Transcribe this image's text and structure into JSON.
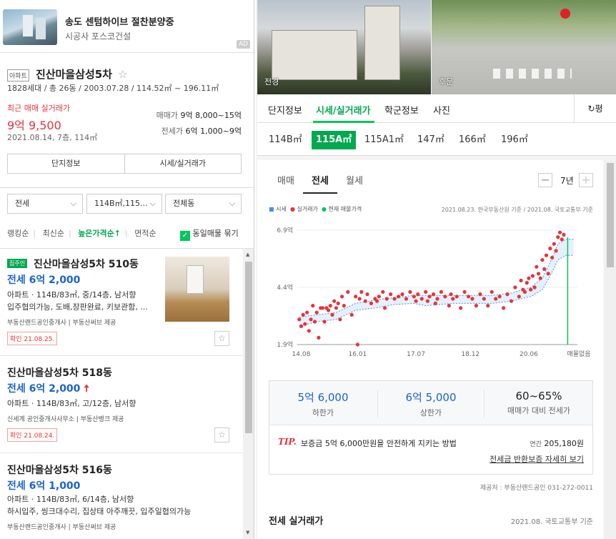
{
  "ad": {
    "title": "송도 센텀하이브 절찬분양중",
    "builder": "시공사 포스코건설",
    "badge": "AD"
  },
  "complex": {
    "type_tag": "아파트",
    "name": "진산마을삼성5차",
    "star": "☆",
    "info": "1828세대 / 총 26동 / 2003.07.28 / 114.52㎡ ~ 196.11㎡",
    "recent_label": "최근 매매 실거래가",
    "recent_price": "9억 9,500",
    "recent_meta": "2021.08.14, 7층, 114㎡",
    "sale_label": "매매가",
    "sale_range": "9억 8,000~15억",
    "jeonse_label": "전세가",
    "jeonse_range": "6억 1,000~9억",
    "btn_info": "단지정보",
    "btn_price": "시세/실거래가"
  },
  "filters": {
    "trade": "전세",
    "area": "114B㎡,115...",
    "dong": "전체동",
    "sort_ranking": "랭킹순",
    "sort_recent": "최신순",
    "sort_price": "높은가격순",
    "sort_price_arrow": "↑",
    "sort_area": "면적순",
    "group_same": "동일매물 묶기"
  },
  "listings": [
    {
      "badge": "집주인",
      "title": "진산마을삼성5차 510동",
      "price": "전세 6억 2,000",
      "desc": "아파트 · 114B/83㎡, 중/14층, 남서향",
      "extra": "입주협의가능, 도배,장판완료, 키보관함, ...",
      "source": "부동산랜드공인중개사 | 부동산써브 제공",
      "confirm": "확인 21.08.25."
    },
    {
      "title": "진산마을삼성5차 518동",
      "price": "전세 6억 2,000",
      "up": "🠅",
      "desc": "아파트 · 114B/83㎡, 고/12층, 남서향",
      "source": "신세계 공인중개사사무소 | 부동산뱅크 제공",
      "confirm": "확인 21.08.24."
    },
    {
      "title": "진산마을삼성5차 516동",
      "price": "전세 6억 1,000",
      "desc": "아파트 · 114B/83㎡, 6/14층, 남서향",
      "extra": "하시입주, 씽크대수리, 집상태 아주깨끗, 입주일협의가능",
      "source": "부동산랜드공인중개사 | 부동산써브 제공"
    }
  ],
  "photos": {
    "front": "전경",
    "back": "후문"
  },
  "detail_tabs": [
    "단지정보",
    "시세/실거래가",
    "학군정보",
    "사진"
  ],
  "refresh_label": "평",
  "sizes": [
    "114B㎡",
    "115A㎡",
    "115A1㎡",
    "147㎡",
    "166㎡",
    "196㎡"
  ],
  "price_tabs": [
    "매매",
    "전세",
    "월세"
  ],
  "period": {
    "label": "7년",
    "minus": "−",
    "plus": "+"
  },
  "legend": {
    "market": "시세",
    "real": "실거래가",
    "current": "현재 매물가격",
    "source": "2021.08.23. 한국부동산원 기준 / 2021.08. 국토교통부 기준"
  },
  "colors": {
    "accent": "#03c75a",
    "price_blue": "#1a64c8",
    "red": "#e3343c",
    "market_blue": "#4a90d9"
  },
  "chart_data": {
    "type": "scatter",
    "x_ticks": [
      "14.08",
      "16.01",
      "17.07",
      "18.12",
      "20.06"
    ],
    "y_ticks": [
      "1.9억",
      "4.4억",
      "6.9억"
    ],
    "ylim": [
      1.9,
      6.9
    ],
    "xlim": [
      2014.5,
      2021.7
    ],
    "no_listing_label": "매물없음",
    "series": [
      {
        "name": "실거래가",
        "points": [
          [
            2014.55,
            3.0
          ],
          [
            2014.6,
            2.7
          ],
          [
            2014.65,
            3.2
          ],
          [
            2014.7,
            2.8
          ],
          [
            2014.75,
            3.3
          ],
          [
            2014.8,
            2.5
          ],
          [
            2014.85,
            3.0
          ],
          [
            2014.9,
            3.6
          ],
          [
            2014.95,
            2.9
          ],
          [
            2015.0,
            3.3
          ],
          [
            2015.05,
            2.2
          ],
          [
            2015.1,
            3.5
          ],
          [
            2015.15,
            3.5
          ],
          [
            2015.2,
            2.9
          ],
          [
            2015.25,
            3.5
          ],
          [
            2015.3,
            3.4
          ],
          [
            2015.35,
            3.6
          ],
          [
            2015.4,
            3.2
          ],
          [
            2015.45,
            3.8
          ],
          [
            2015.5,
            3.5
          ],
          [
            2015.55,
            3.7
          ],
          [
            2015.6,
            3.0
          ],
          [
            2015.65,
            4.0
          ],
          [
            2015.7,
            3.6
          ],
          [
            2015.8,
            4.2
          ],
          [
            2015.9,
            3.2
          ],
          [
            2016.0,
            4.0
          ],
          [
            2016.05,
            1.9
          ],
          [
            2016.1,
            3.9
          ],
          [
            2016.15,
            4.2
          ],
          [
            2016.25,
            3.8
          ],
          [
            2016.3,
            4.1
          ],
          [
            2016.4,
            3.7
          ],
          [
            2016.5,
            3.9
          ],
          [
            2016.55,
            3.8
          ],
          [
            2016.6,
            4.0
          ],
          [
            2016.7,
            4.2
          ],
          [
            2016.75,
            3.5
          ],
          [
            2016.8,
            3.9
          ],
          [
            2016.9,
            4.1
          ],
          [
            2017.0,
            3.9
          ],
          [
            2017.1,
            4.0
          ],
          [
            2017.2,
            4.1
          ],
          [
            2017.3,
            3.9
          ],
          [
            2017.4,
            4.2
          ],
          [
            2017.5,
            4.0
          ],
          [
            2017.55,
            3.8
          ],
          [
            2017.6,
            4.1
          ],
          [
            2017.7,
            3.9
          ],
          [
            2017.8,
            4.2
          ],
          [
            2017.85,
            3.8
          ],
          [
            2017.9,
            4.0
          ],
          [
            2018.0,
            4.1
          ],
          [
            2018.05,
            3.7
          ],
          [
            2018.1,
            3.9
          ],
          [
            2018.2,
            4.2
          ],
          [
            2018.3,
            4.0
          ],
          [
            2018.4,
            3.6
          ],
          [
            2018.45,
            4.1
          ],
          [
            2018.5,
            3.9
          ],
          [
            2018.6,
            4.0
          ],
          [
            2018.7,
            3.5
          ],
          [
            2018.8,
            4.2
          ],
          [
            2018.9,
            4.0
          ],
          [
            2019.0,
            3.9
          ],
          [
            2019.1,
            3.6
          ],
          [
            2019.2,
            4.1
          ],
          [
            2019.3,
            3.9
          ],
          [
            2019.4,
            3.6
          ],
          [
            2019.5,
            4.2
          ],
          [
            2019.6,
            3.9
          ],
          [
            2019.7,
            4.0
          ],
          [
            2019.8,
            3.5
          ],
          [
            2019.9,
            4.1
          ],
          [
            2020.0,
            3.8
          ],
          [
            2020.1,
            4.4
          ],
          [
            2020.2,
            4.0
          ],
          [
            2020.25,
            4.7
          ],
          [
            2020.3,
            4.3
          ],
          [
            2020.35,
            4.2
          ],
          [
            2020.4,
            4.6
          ],
          [
            2020.45,
            4.8
          ],
          [
            2020.5,
            4.3
          ],
          [
            2020.55,
            4.9
          ],
          [
            2020.6,
            4.4
          ],
          [
            2020.65,
            5.3
          ],
          [
            2020.7,
            5.0
          ],
          [
            2020.75,
            4.8
          ],
          [
            2020.8,
            5.6
          ],
          [
            2020.85,
            5.2
          ],
          [
            2020.9,
            5.8
          ],
          [
            2020.95,
            5.0
          ],
          [
            2021.0,
            6.1
          ],
          [
            2021.05,
            5.7
          ],
          [
            2021.1,
            6.3
          ],
          [
            2021.15,
            6.0
          ],
          [
            2021.2,
            6.6
          ],
          [
            2021.25,
            6.8
          ],
          [
            2021.3,
            6.5
          ],
          [
            2021.35,
            6.7
          ]
        ]
      },
      {
        "name": "시세",
        "upper": [
          [
            2014.55,
            3.1
          ],
          [
            2015.0,
            3.2
          ],
          [
            2015.5,
            3.3
          ],
          [
            2016.0,
            3.7
          ],
          [
            2016.5,
            3.85
          ],
          [
            2017.0,
            3.95
          ],
          [
            2017.5,
            4.05
          ],
          [
            2018.0,
            4.05
          ],
          [
            2018.5,
            4.05
          ],
          [
            2019.0,
            4.05
          ],
          [
            2019.5,
            4.05
          ],
          [
            2020.0,
            4.15
          ],
          [
            2020.5,
            4.4
          ],
          [
            2020.8,
            4.8
          ],
          [
            2021.0,
            5.5
          ],
          [
            2021.2,
            6.3
          ],
          [
            2021.4,
            6.5
          ],
          [
            2021.6,
            6.5
          ]
        ],
        "lower": [
          [
            2014.55,
            2.7
          ],
          [
            2015.0,
            2.9
          ],
          [
            2015.5,
            3.0
          ],
          [
            2016.0,
            3.4
          ],
          [
            2016.5,
            3.5
          ],
          [
            2017.0,
            3.65
          ],
          [
            2017.5,
            3.7
          ],
          [
            2017.8,
            3.6
          ],
          [
            2018.5,
            3.7
          ],
          [
            2019.0,
            3.7
          ],
          [
            2019.5,
            3.7
          ],
          [
            2020.0,
            3.8
          ],
          [
            2020.5,
            4.0
          ],
          [
            2020.8,
            4.3
          ],
          [
            2021.0,
            4.9
          ],
          [
            2021.2,
            5.6
          ],
          [
            2021.4,
            5.8
          ],
          [
            2021.6,
            5.8
          ]
        ]
      }
    ]
  },
  "summary": {
    "low_value": "5억 6,000",
    "low_label": "하한가",
    "high_value": "6억 5,000",
    "high_label": "상한가",
    "ratio_value": "60~65%",
    "ratio_label": "매매가 대비 전세가",
    "tip": "TIP.",
    "tip_text": "보증금 5억 6,000만원을 안전하게 지키는 방법",
    "annual_label": "연간",
    "annual_value": "205,180원",
    "guarantee_link": "전세금 반환보증 자세히 보기"
  },
  "provider": "제공처 : 부동산랜드공인 031-272-0011",
  "jeonse_section": {
    "title": "전세 실거래가",
    "basis": "2021.08. 국토교통부 기준"
  }
}
